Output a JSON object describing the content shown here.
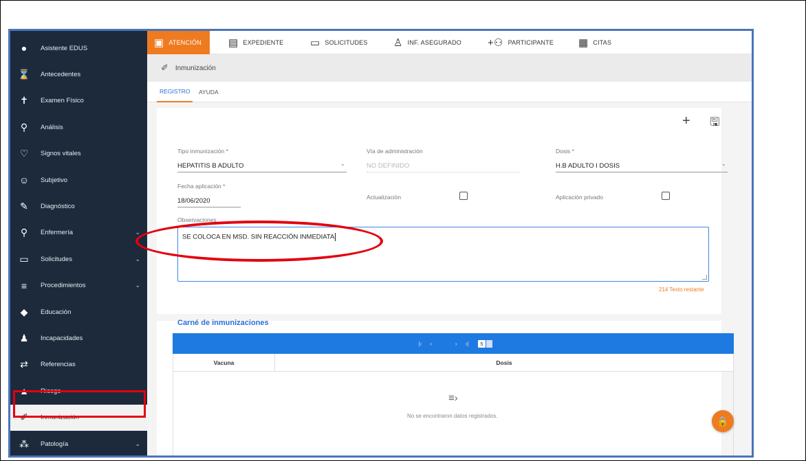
{
  "sidebar": {
    "items": [
      {
        "label": "Asistente EDUS",
        "icon": "globe-icon",
        "glyph": "●",
        "chevron": false
      },
      {
        "label": "Antecedentes",
        "icon": "hourglass-icon",
        "glyph": "⌛",
        "chevron": false
      },
      {
        "label": "Examen Físico",
        "icon": "person-icon",
        "glyph": "✝",
        "chevron": false
      },
      {
        "label": "Análisis",
        "icon": "zoom-icon",
        "glyph": "⚲",
        "chevron": false
      },
      {
        "label": "Signos vitales",
        "icon": "heart-icon",
        "glyph": "♡",
        "chevron": false
      },
      {
        "label": "Subjetivo",
        "icon": "face-icon",
        "glyph": "☺",
        "chevron": false
      },
      {
        "label": "Diagnóstico",
        "icon": "edit-line-icon",
        "glyph": "✎",
        "chevron": false
      },
      {
        "label": "Enfermería",
        "icon": "location-pin-icon",
        "glyph": "⚲",
        "chevron": true
      },
      {
        "label": "Solicitudes",
        "icon": "monitor-icon",
        "glyph": "▭",
        "chevron": true
      },
      {
        "label": "Procedimientos",
        "icon": "menu-lines-icon",
        "glyph": "≡",
        "chevron": true
      },
      {
        "label": "Educación",
        "icon": "graduation-cap-icon",
        "glyph": "◆",
        "chevron": false
      },
      {
        "label": "Incapacidades",
        "icon": "person-bed-icon",
        "glyph": "♟",
        "chevron": false
      },
      {
        "label": "Referencias",
        "icon": "swap-arrows-icon",
        "glyph": "⇄",
        "chevron": false
      },
      {
        "label": "Riesgo",
        "icon": "warning-icon",
        "glyph": "▲",
        "chevron": false
      },
      {
        "label": "Inmunización",
        "icon": "syringe-pencil-icon",
        "glyph": "✐",
        "chevron": false,
        "active": true
      },
      {
        "label": "Patología",
        "icon": "molecule-icon",
        "glyph": "⁂",
        "chevron": true
      }
    ],
    "chevron_glyph": "⌄"
  },
  "topbar": {
    "tabs": [
      {
        "label": "ATENCIÓN",
        "icon": "attention-icon",
        "glyph": "▣",
        "active": true
      },
      {
        "label": "EXPEDIENTE",
        "icon": "folder-icon",
        "glyph": "▤"
      },
      {
        "label": "SOLICITUDES",
        "icon": "monitor-icon",
        "glyph": "▭"
      },
      {
        "label": "INF. ASEGURADO",
        "icon": "person-icon",
        "glyph": "♙"
      },
      {
        "label": "PARTICIPANTE",
        "icon": "add-group-icon",
        "glyph": "+⚇"
      },
      {
        "label": "CITAS",
        "icon": "calendar-icon",
        "glyph": "▦"
      }
    ]
  },
  "module": {
    "title": "Inmunización",
    "icon_glyph": "✐"
  },
  "subtabs": [
    {
      "label": "REGISTRO",
      "active": true
    },
    {
      "label": "AYUDA"
    }
  ],
  "toolbar": {
    "add_glyph": "+",
    "save_glyph": "🖫"
  },
  "form": {
    "tipo": {
      "label": "Tipo inmunización *",
      "value": "HEPATITIS B ADULTO"
    },
    "via": {
      "label": "Vía de administración",
      "value": "NO DEFINIDO"
    },
    "dosis": {
      "label": "Dosis *",
      "value": "H.B ADULTO I DOSIS"
    },
    "fecha": {
      "label": "Fecha aplicación *",
      "value": "18/06/2020"
    },
    "actualizacion": {
      "label": "Actualización",
      "checked": false
    },
    "privado": {
      "label": "Aplicación privado",
      "checked": false
    },
    "observaciones": {
      "label": "Observaciones",
      "value": "SE COLOCA EN MSD. SIN REACCIÓN INMEDIATA"
    },
    "remaining": "214 Texto restante",
    "caret_glyph": "⌄"
  },
  "carne": {
    "title": "Carné de inmunizaciones",
    "pager": {
      "first": "|‹",
      "prev": "‹",
      "next": "›",
      "last": "›|",
      "page_size": "5"
    },
    "columns": [
      "Vacuna",
      "Dosis"
    ],
    "empty_glyph": "≡›",
    "empty_text": "No se encontraron datos registrados."
  },
  "fab": {
    "glyph": "🔒"
  },
  "colors": {
    "accent": "#ef7b21",
    "sidebar_bg": "#1c2a3c",
    "primary": "#1e7ae0",
    "annotation": "#e3000f"
  }
}
